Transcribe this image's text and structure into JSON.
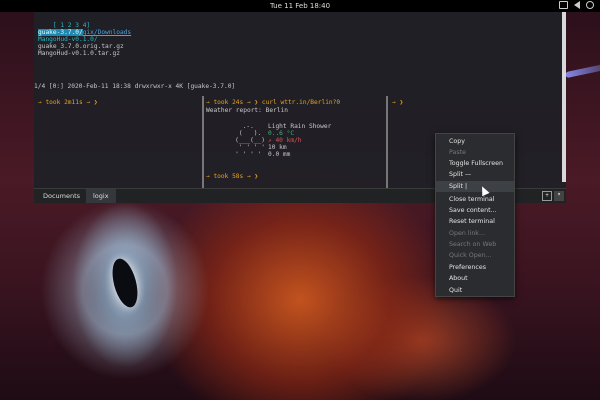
{
  "topbar": {
    "clock": "Tue 11 Feb  18:40"
  },
  "terminal": {
    "prompt_line": {
      "prefix": "[ 1 2 3 4]",
      "path": "/home/logix/Downloads"
    },
    "files": [
      {
        "name": "guake-3.7.0/",
        "highlight": true
      },
      {
        "name": "MangoHud-v0.1.0/",
        "highlight": false
      },
      {
        "name": "guake_3.7.0.orig.tar.gz",
        "highlight": false
      },
      {
        "name": "MangoHud-v0.1.0.tar.gz",
        "highlight": false
      }
    ],
    "status_line": "1/4 [0:] 2020-Feb-11 18:38 drwxrwxr-x 4K [guake-3.7.0]",
    "pane1": {
      "prompt": "→ took 2m11s → ❯"
    },
    "pane2": {
      "prompt1": "→ took 24s → ❯ curl wttr.in/Berlin?0",
      "report_title": "Weather report: Berlin",
      "art": [
        "     .-.     ",
        "    (   ).   ",
        "   (___(__)  ",
        "    ' ' ' '  ",
        "   ' ' ' '   "
      ],
      "condition": "Light Rain Shower",
      "temperature": "0..6 °C",
      "wind": "↗ 40 km/h",
      "visibility": "10 km",
      "precip": "0.0 mm",
      "prompt2": "→ took 58s → ❯"
    },
    "pane3": {
      "prompt": "→ ❯"
    }
  },
  "tabs": [
    {
      "label": "Documents",
      "active": false
    },
    {
      "label": "logix",
      "active": true
    }
  ],
  "context_menu": {
    "items": [
      {
        "label": "Copy",
        "disabled": false
      },
      {
        "label": "Paste",
        "disabled": true
      },
      {
        "label": "Toggle Fullscreen",
        "disabled": false
      },
      {
        "label": "Split —",
        "disabled": false
      },
      {
        "label": "Split |",
        "disabled": false,
        "hover": true
      },
      {
        "label": "Close terminal",
        "disabled": false
      },
      {
        "label": "Save content...",
        "disabled": false
      },
      {
        "label": "Reset terminal",
        "disabled": false
      },
      {
        "label": "Open link...",
        "disabled": true
      },
      {
        "label": "Search on Web",
        "disabled": true
      },
      {
        "label": "Quick Open...",
        "disabled": true
      },
      {
        "label": "Preferences",
        "disabled": false
      },
      {
        "label": "About",
        "disabled": false
      },
      {
        "label": "Quit",
        "disabled": false
      }
    ]
  }
}
